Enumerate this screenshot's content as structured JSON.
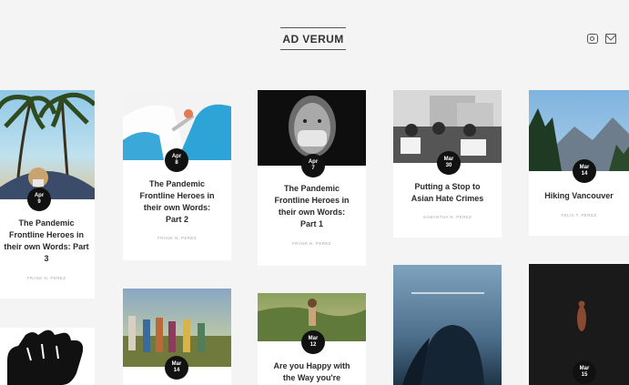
{
  "site": {
    "title": "AD VERUM"
  },
  "social": {
    "instagram_icon": "instagram-icon",
    "email_icon": "mail-icon"
  },
  "posts": [
    {
      "title": "The Pandemic Frontline Heroes in their own Words: Part 3",
      "author": "Frank N. Perez",
      "date": {
        "month": "Apr",
        "day": "9"
      }
    },
    {
      "title": "The Pandemic Frontline Heroes in their own Words: Part 2",
      "author": "Frank N. Perez",
      "date": {
        "month": "Apr",
        "day": "8"
      }
    },
    {
      "title": "The Pandemic Frontline Heroes in their own Words: Part 1",
      "author": "Frank N. Perez",
      "date": {
        "month": "Apr",
        "day": "7"
      }
    },
    {
      "title": "Putting a Stop to Asian Hate Crimes",
      "author": "Samantha R. Perez",
      "date": {
        "month": "Mar",
        "day": "30"
      }
    },
    {
      "title": "Hiking Vancouver",
      "author": "Felix T. Perez",
      "date": {
        "month": "Mar",
        "day": "14"
      }
    },
    {
      "title": "Are you Happy with the Way you're",
      "author": "",
      "date": {
        "month": "Mar",
        "day": "12"
      }
    },
    {
      "title": "",
      "author": "",
      "date": {
        "month": "Mar",
        "day": "15"
      }
    },
    {
      "title": "",
      "author": "",
      "date": {
        "month": "Mar",
        "day": "14"
      }
    }
  ]
}
